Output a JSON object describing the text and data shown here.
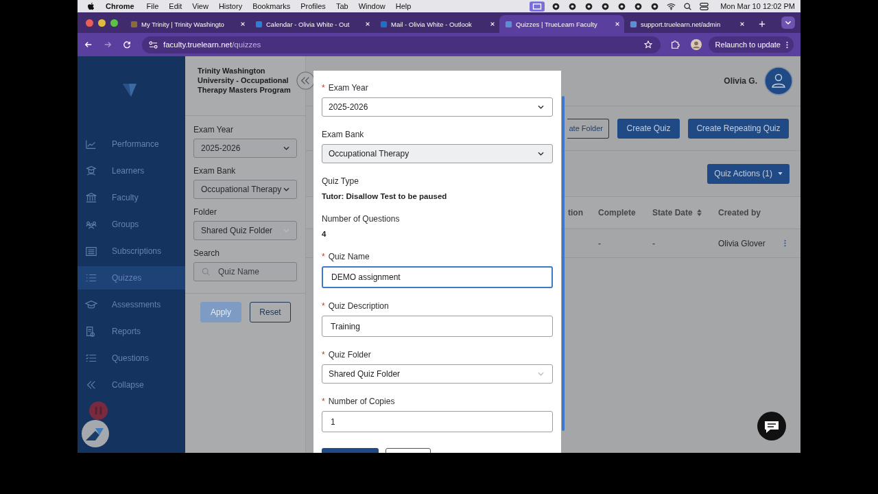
{
  "menu_bar": {
    "app": "Chrome",
    "items": [
      "File",
      "Edit",
      "View",
      "History",
      "Bookmarks",
      "Profiles",
      "Tab",
      "Window",
      "Help"
    ],
    "clock": "Mon Mar 10  12:02 PM"
  },
  "tabs": [
    {
      "title": "My Trinity | Trinity Washingto",
      "selected": false
    },
    {
      "title": "Calendar - Olivia White - Out",
      "selected": false
    },
    {
      "title": "Mail - Olivia White - Outlook",
      "selected": false
    },
    {
      "title": "Quizzes | TrueLearn Faculty",
      "selected": true
    },
    {
      "title": "support.truelearn.net/admin",
      "selected": false
    }
  ],
  "address_bar": {
    "host": "faculty.truelearn.net",
    "path": "/quizzes",
    "relaunch": "Relaunch to update"
  },
  "sidebar": {
    "items": [
      {
        "label": "Performance",
        "selected": false
      },
      {
        "label": "Learners",
        "selected": false
      },
      {
        "label": "Faculty",
        "selected": false
      },
      {
        "label": "Groups",
        "selected": false
      },
      {
        "label": "Subscriptions",
        "selected": false
      },
      {
        "label": "Quizzes",
        "selected": true
      },
      {
        "label": "Assessments",
        "selected": false
      },
      {
        "label": "Reports",
        "selected": false
      },
      {
        "label": "Questions",
        "selected": false
      },
      {
        "label": "Collapse",
        "selected": false
      }
    ]
  },
  "filter_panel": {
    "title": "Trinity Washington University - Occupational Therapy Masters Program",
    "fields": [
      {
        "label": "Exam Year",
        "kind": "select",
        "value": "2025-2026"
      },
      {
        "label": "Exam Bank",
        "kind": "select",
        "value": "Occupational Therapy"
      },
      {
        "label": "Folder",
        "kind": "select",
        "value": "Shared Quiz Folder"
      },
      {
        "label": "Search",
        "kind": "search",
        "placeholder": "Quiz Name"
      }
    ],
    "buttons": [
      {
        "label": "Apply",
        "disabled": true
      },
      {
        "label": "Reset",
        "disabled": false
      }
    ]
  },
  "header": {
    "user_name": "Olivia G."
  },
  "actions": [
    {
      "label": "ate Folder",
      "kind": "outline"
    },
    {
      "label": "Create Quiz",
      "kind": "primary"
    },
    {
      "label": "Create Repeating Quiz",
      "kind": "primary"
    }
  ],
  "quiz_actions": "Quiz Actions (1)",
  "table": {
    "columns": [
      {
        "label": "tion",
        "sortable": false
      },
      {
        "label": "Complete",
        "sortable": false
      },
      {
        "label": "State Date",
        "sortable": true
      },
      {
        "label": "Created by",
        "sortable": false
      }
    ],
    "rows": [
      {
        "complete": "-",
        "state_date": "-",
        "created_by": "Olivia Glover"
      }
    ]
  },
  "modal": {
    "fields": [
      {
        "label": "Exam Year",
        "required_mark": "*",
        "kind": "select",
        "value": "2025-2026",
        "disabled": false,
        "faint_caret": false
      },
      {
        "label": "Exam Bank",
        "kind": "select",
        "value": "Occupational Therapy",
        "disabled": true,
        "faint_caret": false
      },
      {
        "label": "Quiz Type",
        "kind": "info",
        "value": "Tutor:  Disallow Test to be paused"
      },
      {
        "label": "Number of Questions",
        "kind": "info",
        "value": "4"
      },
      {
        "label": "Quiz Name",
        "required_mark": "*",
        "kind": "input",
        "value": "DEMO assignment",
        "focused": true
      },
      {
        "label": "Quiz Description",
        "required_mark": "*",
        "kind": "input",
        "value": "Training",
        "focused": false
      },
      {
        "label": "Quiz Folder",
        "required_mark": "*",
        "kind": "select",
        "value": "Shared Quiz Folder",
        "disabled": false,
        "faint_caret": true
      },
      {
        "label": "Number of Copies",
        "required_mark": "*",
        "kind": "input",
        "value": "1",
        "focused": false
      }
    ]
  }
}
